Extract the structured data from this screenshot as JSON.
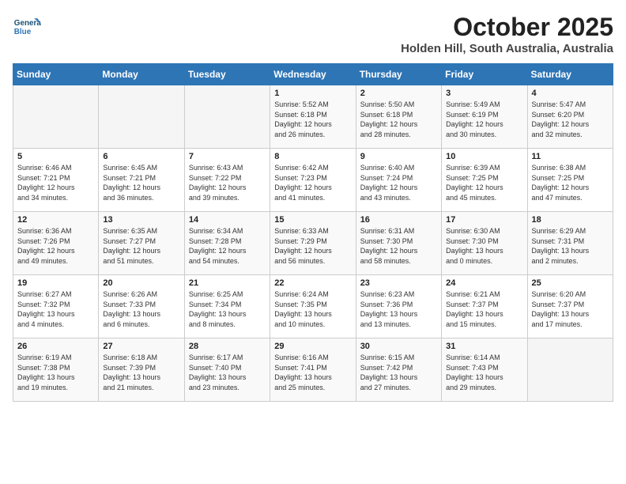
{
  "header": {
    "logo_line1": "General",
    "logo_line2": "Blue",
    "month_year": "October 2025",
    "location": "Holden Hill, South Australia, Australia"
  },
  "days_of_week": [
    "Sunday",
    "Monday",
    "Tuesday",
    "Wednesday",
    "Thursday",
    "Friday",
    "Saturday"
  ],
  "weeks": [
    [
      {
        "day": "",
        "info": ""
      },
      {
        "day": "",
        "info": ""
      },
      {
        "day": "",
        "info": ""
      },
      {
        "day": "1",
        "info": "Sunrise: 5:52 AM\nSunset: 6:18 PM\nDaylight: 12 hours\nand 26 minutes."
      },
      {
        "day": "2",
        "info": "Sunrise: 5:50 AM\nSunset: 6:18 PM\nDaylight: 12 hours\nand 28 minutes."
      },
      {
        "day": "3",
        "info": "Sunrise: 5:49 AM\nSunset: 6:19 PM\nDaylight: 12 hours\nand 30 minutes."
      },
      {
        "day": "4",
        "info": "Sunrise: 5:47 AM\nSunset: 6:20 PM\nDaylight: 12 hours\nand 32 minutes."
      }
    ],
    [
      {
        "day": "5",
        "info": "Sunrise: 6:46 AM\nSunset: 7:21 PM\nDaylight: 12 hours\nand 34 minutes."
      },
      {
        "day": "6",
        "info": "Sunrise: 6:45 AM\nSunset: 7:21 PM\nDaylight: 12 hours\nand 36 minutes."
      },
      {
        "day": "7",
        "info": "Sunrise: 6:43 AM\nSunset: 7:22 PM\nDaylight: 12 hours\nand 39 minutes."
      },
      {
        "day": "8",
        "info": "Sunrise: 6:42 AM\nSunset: 7:23 PM\nDaylight: 12 hours\nand 41 minutes."
      },
      {
        "day": "9",
        "info": "Sunrise: 6:40 AM\nSunset: 7:24 PM\nDaylight: 12 hours\nand 43 minutes."
      },
      {
        "day": "10",
        "info": "Sunrise: 6:39 AM\nSunset: 7:25 PM\nDaylight: 12 hours\nand 45 minutes."
      },
      {
        "day": "11",
        "info": "Sunrise: 6:38 AM\nSunset: 7:25 PM\nDaylight: 12 hours\nand 47 minutes."
      }
    ],
    [
      {
        "day": "12",
        "info": "Sunrise: 6:36 AM\nSunset: 7:26 PM\nDaylight: 12 hours\nand 49 minutes."
      },
      {
        "day": "13",
        "info": "Sunrise: 6:35 AM\nSunset: 7:27 PM\nDaylight: 12 hours\nand 51 minutes."
      },
      {
        "day": "14",
        "info": "Sunrise: 6:34 AM\nSunset: 7:28 PM\nDaylight: 12 hours\nand 54 minutes."
      },
      {
        "day": "15",
        "info": "Sunrise: 6:33 AM\nSunset: 7:29 PM\nDaylight: 12 hours\nand 56 minutes."
      },
      {
        "day": "16",
        "info": "Sunrise: 6:31 AM\nSunset: 7:30 PM\nDaylight: 12 hours\nand 58 minutes."
      },
      {
        "day": "17",
        "info": "Sunrise: 6:30 AM\nSunset: 7:30 PM\nDaylight: 13 hours\nand 0 minutes."
      },
      {
        "day": "18",
        "info": "Sunrise: 6:29 AM\nSunset: 7:31 PM\nDaylight: 13 hours\nand 2 minutes."
      }
    ],
    [
      {
        "day": "19",
        "info": "Sunrise: 6:27 AM\nSunset: 7:32 PM\nDaylight: 13 hours\nand 4 minutes."
      },
      {
        "day": "20",
        "info": "Sunrise: 6:26 AM\nSunset: 7:33 PM\nDaylight: 13 hours\nand 6 minutes."
      },
      {
        "day": "21",
        "info": "Sunrise: 6:25 AM\nSunset: 7:34 PM\nDaylight: 13 hours\nand 8 minutes."
      },
      {
        "day": "22",
        "info": "Sunrise: 6:24 AM\nSunset: 7:35 PM\nDaylight: 13 hours\nand 10 minutes."
      },
      {
        "day": "23",
        "info": "Sunrise: 6:23 AM\nSunset: 7:36 PM\nDaylight: 13 hours\nand 13 minutes."
      },
      {
        "day": "24",
        "info": "Sunrise: 6:21 AM\nSunset: 7:37 PM\nDaylight: 13 hours\nand 15 minutes."
      },
      {
        "day": "25",
        "info": "Sunrise: 6:20 AM\nSunset: 7:37 PM\nDaylight: 13 hours\nand 17 minutes."
      }
    ],
    [
      {
        "day": "26",
        "info": "Sunrise: 6:19 AM\nSunset: 7:38 PM\nDaylight: 13 hours\nand 19 minutes."
      },
      {
        "day": "27",
        "info": "Sunrise: 6:18 AM\nSunset: 7:39 PM\nDaylight: 13 hours\nand 21 minutes."
      },
      {
        "day": "28",
        "info": "Sunrise: 6:17 AM\nSunset: 7:40 PM\nDaylight: 13 hours\nand 23 minutes."
      },
      {
        "day": "29",
        "info": "Sunrise: 6:16 AM\nSunset: 7:41 PM\nDaylight: 13 hours\nand 25 minutes."
      },
      {
        "day": "30",
        "info": "Sunrise: 6:15 AM\nSunset: 7:42 PM\nDaylight: 13 hours\nand 27 minutes."
      },
      {
        "day": "31",
        "info": "Sunrise: 6:14 AM\nSunset: 7:43 PM\nDaylight: 13 hours\nand 29 minutes."
      },
      {
        "day": "",
        "info": ""
      }
    ]
  ]
}
